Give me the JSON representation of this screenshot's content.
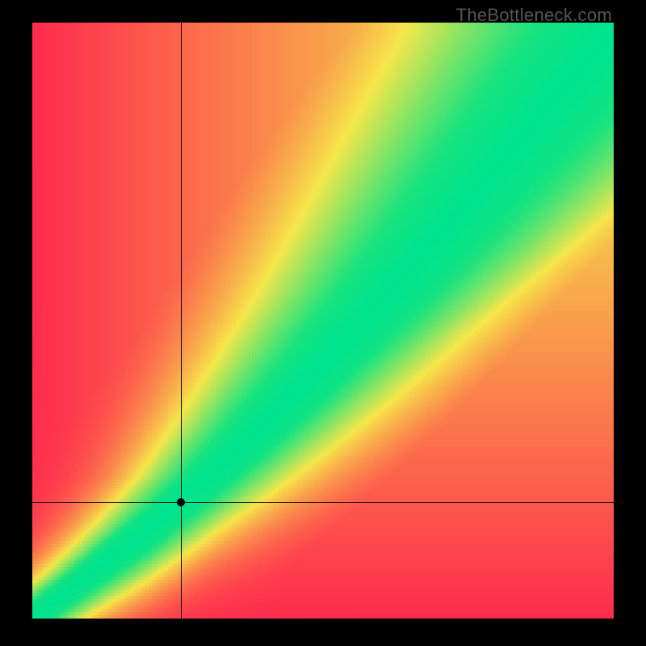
{
  "attribution": "TheBottleneck.com",
  "chart_data": {
    "type": "heatmap",
    "title": "",
    "xlabel": "",
    "ylabel": "",
    "xlim": [
      0,
      1
    ],
    "ylim": [
      0,
      1
    ],
    "crosshair": {
      "x": 0.255,
      "y": 0.195
    },
    "marker": {
      "x": 0.255,
      "y": 0.195
    },
    "colorscale": {
      "description": "compatibility score (0=red/worst, 1=green/best) with yellow midband",
      "stops": [
        {
          "t": 0.0,
          "hex": "#ff2a4d"
        },
        {
          "t": 0.5,
          "hex": "#f6e64a"
        },
        {
          "t": 0.88,
          "hex": "#17e37f"
        },
        {
          "t": 1.0,
          "hex": "#00e38e"
        }
      ]
    },
    "optimal_ridge": {
      "description": "approximate y along the green ridge for sampled x",
      "points": [
        {
          "x": 0.0,
          "y": 0.0
        },
        {
          "x": 0.1,
          "y": 0.075
        },
        {
          "x": 0.2,
          "y": 0.15
        },
        {
          "x": 0.3,
          "y": 0.235
        },
        {
          "x": 0.4,
          "y": 0.33
        },
        {
          "x": 0.5,
          "y": 0.43
        },
        {
          "x": 0.6,
          "y": 0.535
        },
        {
          "x": 0.7,
          "y": 0.645
        },
        {
          "x": 0.8,
          "y": 0.76
        },
        {
          "x": 0.9,
          "y": 0.875
        },
        {
          "x": 1.0,
          "y": 0.985
        }
      ],
      "band_halfwidth_at_x": [
        {
          "x": 0.05,
          "hw": 0.018
        },
        {
          "x": 0.3,
          "hw": 0.03
        },
        {
          "x": 0.6,
          "hw": 0.055
        },
        {
          "x": 1.0,
          "hw": 0.09
        }
      ]
    },
    "grid_resolution": 128
  }
}
